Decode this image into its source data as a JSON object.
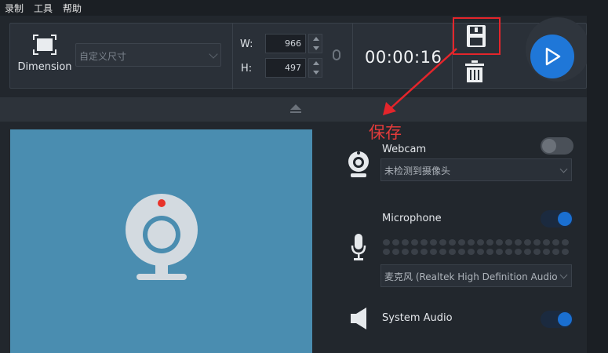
{
  "menu": {
    "record": "录制",
    "tools": "工具",
    "help": "帮助"
  },
  "toolbar": {
    "dimension_label": "Dimension",
    "size_select_value": "自定义尺寸",
    "width_label": "W:",
    "height_label": "H:",
    "width_value": "966",
    "height_value": "497",
    "timer": "00:00:16"
  },
  "annotation": {
    "save_text": "保存",
    "color": "#e4252b"
  },
  "panel": {
    "webcam": {
      "label": "Webcam",
      "device": "未检测到摄像头",
      "enabled": false
    },
    "microphone": {
      "label": "Microphone",
      "device": "麦克风 (Realtek High Definition Audio",
      "enabled": true
    },
    "system_audio": {
      "label": "System Audio",
      "enabled": true
    }
  },
  "colors": {
    "accent": "#1f77d8",
    "preview_bg": "#4a8db0",
    "webcam_dot": "#e8332a"
  },
  "icons": [
    "dimension-icon",
    "save-icon",
    "trash-icon",
    "play-icon",
    "collapse-arrow-icon",
    "webcam-icon",
    "microphone-icon",
    "speaker-icon",
    "link-icon"
  ]
}
